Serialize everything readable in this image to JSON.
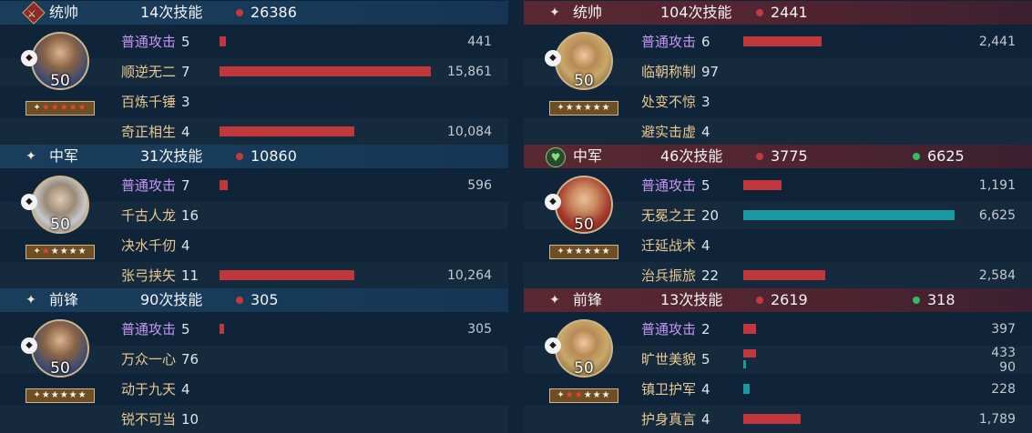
{
  "teams": [
    {
      "side": "left",
      "groups": [
        {
          "role": "统帅",
          "skill_count": "14次技能",
          "damage": "26386",
          "heal": "",
          "level": "50",
          "stars_on": 6,
          "stars_total": 6,
          "skills": [
            {
              "name": "普通攻击",
              "count": "5",
              "value": "441",
              "bar_fraction": 0.03,
              "basic": true,
              "color": "red"
            },
            {
              "name": "顺逆无二",
              "count": "7",
              "value": "15,861",
              "bar_fraction": 1.0,
              "basic": false,
              "color": "red"
            },
            {
              "name": "百炼千锤",
              "count": "3",
              "value": "",
              "bar_fraction": 0,
              "basic": false,
              "color": "red"
            },
            {
              "name": "奇正相生",
              "count": "4",
              "value": "10,084",
              "bar_fraction": 0.64,
              "basic": false,
              "color": "red"
            }
          ]
        },
        {
          "role": "中军",
          "skill_count": "31次技能",
          "damage": "10860",
          "heal": "",
          "level": "50",
          "stars_on": 1,
          "stars_total": 6,
          "skills": [
            {
              "name": "普通攻击",
              "count": "7",
              "value": "596",
              "bar_fraction": 0.04,
              "basic": true,
              "color": "red"
            },
            {
              "name": "千古人龙",
              "count": "16",
              "value": "",
              "bar_fraction": 0,
              "basic": false,
              "color": "red"
            },
            {
              "name": "决水千仞",
              "count": "4",
              "value": "",
              "bar_fraction": 0,
              "basic": false,
              "color": "red"
            },
            {
              "name": "张弓挟矢",
              "count": "11",
              "value": "10,264",
              "bar_fraction": 0.64,
              "basic": false,
              "color": "red"
            }
          ]
        },
        {
          "role": "前锋",
          "skill_count": "90次技能",
          "damage": "305",
          "heal": "",
          "level": "50",
          "stars_on": 0,
          "stars_total": 6,
          "skills": [
            {
              "name": "普通攻击",
              "count": "5",
              "value": "305",
              "bar_fraction": 0.02,
              "basic": true,
              "color": "red"
            },
            {
              "name": "万众一心",
              "count": "76",
              "value": "",
              "bar_fraction": 0,
              "basic": false,
              "color": "red"
            },
            {
              "name": "动于九天",
              "count": "4",
              "value": "",
              "bar_fraction": 0,
              "basic": false,
              "color": "red"
            },
            {
              "name": "锐不可当",
              "count": "10",
              "value": "",
              "bar_fraction": 0,
              "basic": false,
              "color": "red"
            }
          ]
        }
      ]
    },
    {
      "side": "right",
      "groups": [
        {
          "role": "统帅",
          "skill_count": "104次技能",
          "damage": "2441",
          "heal": "",
          "level": "50",
          "stars_on": 0,
          "stars_total": 6,
          "skills": [
            {
              "name": "普通攻击",
              "count": "6",
              "value": "2,441",
              "bar_fraction": 0.37,
              "basic": true,
              "color": "red"
            },
            {
              "name": "临朝称制",
              "count": "97",
              "value": "",
              "bar_fraction": 0,
              "basic": false,
              "color": "red"
            },
            {
              "name": "处变不惊",
              "count": "3",
              "value": "",
              "bar_fraction": 0,
              "basic": false,
              "color": "red"
            },
            {
              "name": "避实击虚",
              "count": "4",
              "value": "",
              "bar_fraction": 0,
              "basic": false,
              "color": "red"
            }
          ]
        },
        {
          "role": "中军",
          "skill_count": "46次技能",
          "damage": "3775",
          "heal": "6625",
          "level": "50",
          "stars_on": 0,
          "stars_total": 6,
          "skills": [
            {
              "name": "普通攻击",
              "count": "5",
              "value": "1,191",
              "bar_fraction": 0.18,
              "basic": true,
              "color": "red"
            },
            {
              "name": "无冕之王",
              "count": "20",
              "value": "6,625",
              "bar_fraction": 1.0,
              "basic": false,
              "color": "teal"
            },
            {
              "name": "迁延战术",
              "count": "4",
              "value": "",
              "bar_fraction": 0,
              "basic": false,
              "color": "red"
            },
            {
              "name": "治兵振旅",
              "count": "22",
              "value": "2,584",
              "bar_fraction": 0.39,
              "basic": false,
              "color": "red"
            }
          ]
        },
        {
          "role": "前锋",
          "skill_count": "13次技能",
          "damage": "2619",
          "heal": "318",
          "level": "50",
          "stars_on": 2,
          "stars_total": 6,
          "skills": [
            {
              "name": "普通攻击",
              "count": "2",
              "value": "397",
              "bar_fraction": 0.06,
              "basic": true,
              "color": "red"
            },
            {
              "name": "旷世美貌",
              "count": "5",
              "value": "433",
              "value2": "90",
              "bar_fraction": 0.06,
              "bar2_fraction": 0.015,
              "basic": false,
              "color": "red"
            },
            {
              "name": "镇卫护军",
              "count": "4",
              "value": "228",
              "bar_fraction": 0.03,
              "basic": false,
              "color": "teal"
            },
            {
              "name": "护身真言",
              "count": "4",
              "value": "1,789",
              "bar_fraction": 0.27,
              "basic": false,
              "color": "red"
            }
          ]
        }
      ]
    }
  ],
  "colors": {
    "damage_dot": "#c23a3a",
    "heal_dot": "#2fbf5f",
    "damage_bar": "#c0383c",
    "heal_bar": "#1a9aa0",
    "basic_attack_text": "#c596f2",
    "skill_text": "#e8c890"
  },
  "icons": {
    "commander_badge": "sword-badge-icon",
    "role_sparkle": "sparkle-icon",
    "heal_heart": "heart-icon",
    "troop_type": "troop-type-icon"
  }
}
